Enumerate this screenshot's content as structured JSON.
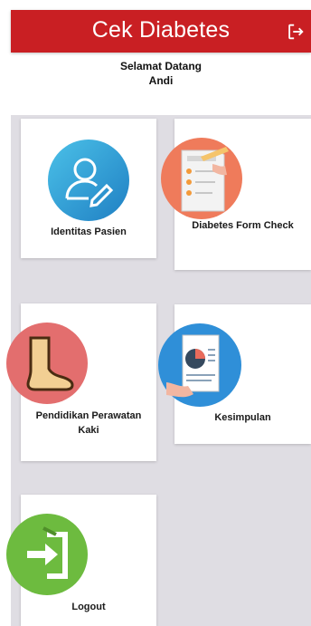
{
  "header": {
    "title": "Cek Diabetes",
    "exit_icon": "logout-arrow-icon"
  },
  "greeting": {
    "line1": "Selamat Datang",
    "line2": "Andi"
  },
  "menu": [
    {
      "label": "Identitas Pasien",
      "icon": "user-edit-icon"
    },
    {
      "label": "Diabetes Form Check",
      "icon": "checklist-form-icon"
    },
    {
      "label": "Pendidikan Perawatan Kaki",
      "icon": "foot-icon"
    },
    {
      "label": "Kesimpulan",
      "icon": "report-chart-icon"
    },
    {
      "label": "Logout",
      "icon": "logout-door-icon"
    }
  ],
  "colors": {
    "app_bar": "#c91f23",
    "background": "#dfdde3",
    "identitas_icon": "#2d9fd7",
    "form_icon": "#ef7b5b",
    "foot_icon": "#e36e6e",
    "kesimpulan_icon": "#2f8fd8",
    "logout_icon": "#6dbb3f"
  }
}
